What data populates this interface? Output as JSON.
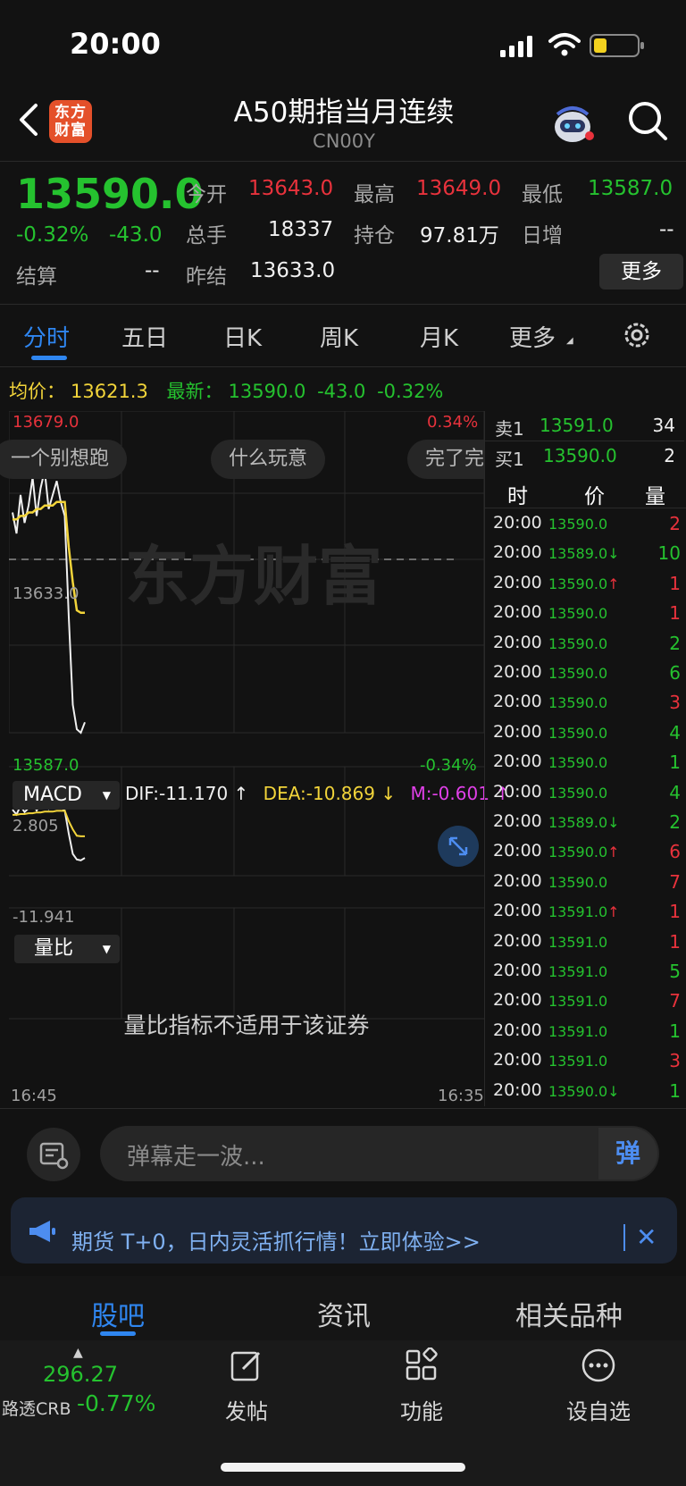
{
  "status": {
    "time": "20:00"
  },
  "header": {
    "logo_text": "东方财富",
    "title": "A50期指当月连续",
    "subtitle": "CN00Y"
  },
  "quote": {
    "price": "13590.0",
    "change_pct": "-0.32%",
    "change": "-43.0",
    "fields": [
      {
        "label": "今开",
        "value": "13643.0",
        "color": "red"
      },
      {
        "label": "最高",
        "value": "13649.0",
        "color": "red"
      },
      {
        "label": "最低",
        "value": "13587.0",
        "color": "green"
      },
      {
        "label": "总手",
        "value": "18337",
        "color": "white"
      },
      {
        "label": "持仓",
        "value": "97.81万",
        "color": "white"
      },
      {
        "label": "日增",
        "value": "--",
        "color": "white"
      },
      {
        "label": "结算",
        "value": "--",
        "color": "white"
      },
      {
        "label": "昨结",
        "value": "13633.0",
        "color": "white"
      }
    ],
    "more_label": "更多"
  },
  "tabs": [
    "分时",
    "五日",
    "日K",
    "周K",
    "月K",
    "更多"
  ],
  "avgline": {
    "avg_label": "均价：",
    "avg_value": "13621.3",
    "last_label": "最新：",
    "last_value": "13590.0",
    "change": "-43.0",
    "change_pct": "-0.32%"
  },
  "chart": {
    "y_top": "13679.0",
    "y_top_pct": "0.34%",
    "y_mid": "13633.0",
    "y_bottom": "13587.0",
    "y_bottom_pct": "-0.34%",
    "watermark": "东方财富",
    "danmu": [
      "一个别想跑",
      "什么玩意",
      "完了完"
    ],
    "time_start": "16:45",
    "time_end": "16:35"
  },
  "macd": {
    "selector": "MACD",
    "dif": "DIF:-11.170 ↑",
    "dea": "DEA:-10.869 ↓",
    "m": "M:-0.601 ↑",
    "top_label": "2.805",
    "bottom_label": "-11.941"
  },
  "volume_ratio": {
    "selector": "量比",
    "message": "量比指标不适用于该证券"
  },
  "chart_data": {
    "type": "line",
    "title": "",
    "ylim": [
      13587.0,
      13679.0
    ],
    "series": [
      {
        "values": [
          13650,
          13644,
          13655,
          13647,
          13652,
          13660,
          13649,
          13657,
          13662,
          13651,
          13655,
          13659,
          13653,
          13649,
          13620,
          13595,
          13588,
          13587,
          13590
        ]
      },
      {
        "values": [
          13648,
          13648,
          13649,
          13649,
          13650,
          13650,
          13651,
          13651,
          13652,
          13652,
          13652,
          13653,
          13653,
          13653,
          13640,
          13630,
          13622,
          13621.3,
          13621.3
        ]
      }
    ]
  },
  "book": {
    "sell": {
      "label": "卖1",
      "price": "13591.0",
      "volume": "34"
    },
    "buy": {
      "label": "买1",
      "price": "13590.0",
      "volume": "2"
    }
  },
  "ticks_header": {
    "time": "时",
    "price": "价",
    "volume": "量"
  },
  "ticks": [
    {
      "time": "20:00",
      "price": "13590.0",
      "arrow": "",
      "volume": "2",
      "color": "red"
    },
    {
      "time": "20:00",
      "price": "13589.0",
      "arrow": "↓",
      "volume": "10",
      "color": "green"
    },
    {
      "time": "20:00",
      "price": "13590.0",
      "arrow": "↑",
      "volume": "1",
      "color": "red"
    },
    {
      "time": "20:00",
      "price": "13590.0",
      "arrow": "",
      "volume": "1",
      "color": "red"
    },
    {
      "time": "20:00",
      "price": "13590.0",
      "arrow": "",
      "volume": "2",
      "color": "green"
    },
    {
      "time": "20:00",
      "price": "13590.0",
      "arrow": "",
      "volume": "6",
      "color": "green"
    },
    {
      "time": "20:00",
      "price": "13590.0",
      "arrow": "",
      "volume": "3",
      "color": "red"
    },
    {
      "time": "20:00",
      "price": "13590.0",
      "arrow": "",
      "volume": "4",
      "color": "green"
    },
    {
      "time": "20:00",
      "price": "13590.0",
      "arrow": "",
      "volume": "1",
      "color": "green"
    },
    {
      "time": "20:00",
      "price": "13590.0",
      "arrow": "",
      "volume": "4",
      "color": "green"
    },
    {
      "time": "20:00",
      "price": "13589.0",
      "arrow": "↓",
      "volume": "2",
      "color": "green"
    },
    {
      "time": "20:00",
      "price": "13590.0",
      "arrow": "↑",
      "volume": "6",
      "color": "red"
    },
    {
      "time": "20:00",
      "price": "13590.0",
      "arrow": "",
      "volume": "7",
      "color": "red"
    },
    {
      "time": "20:00",
      "price": "13591.0",
      "arrow": "↑",
      "volume": "1",
      "color": "red"
    },
    {
      "time": "20:00",
      "price": "13591.0",
      "arrow": "",
      "volume": "1",
      "color": "red"
    },
    {
      "time": "20:00",
      "price": "13591.0",
      "arrow": "",
      "volume": "5",
      "color": "green"
    },
    {
      "time": "20:00",
      "price": "13591.0",
      "arrow": "",
      "volume": "7",
      "color": "red"
    },
    {
      "time": "20:00",
      "price": "13591.0",
      "arrow": "",
      "volume": "1",
      "color": "green"
    },
    {
      "time": "20:00",
      "price": "13591.0",
      "arrow": "",
      "volume": "3",
      "color": "red"
    },
    {
      "time": "20:00",
      "price": "13590.0",
      "arrow": "↓",
      "volume": "1",
      "color": "green"
    }
  ],
  "danmu_input": {
    "placeholder": "弹幕走一波...",
    "send": "弹"
  },
  "banner": {
    "text": "期货 T+0，日内灵活抓行情！立即体验>>",
    "close": "✕"
  },
  "bottom_tabs": [
    "股吧",
    "资讯",
    "相关品种"
  ],
  "footer": {
    "index_value": "296.27",
    "index_name": "路透CRB",
    "index_change": "-0.77%",
    "buttons": [
      {
        "label": "发帖",
        "icon": "edit-icon"
      },
      {
        "label": "功能",
        "icon": "apps-icon"
      },
      {
        "label": "设自选",
        "icon": "more-icon"
      }
    ]
  },
  "colors": {
    "up": "#e8323c",
    "down": "#25c22f",
    "accent": "#2f86f0",
    "avg": "#f2d43a"
  }
}
